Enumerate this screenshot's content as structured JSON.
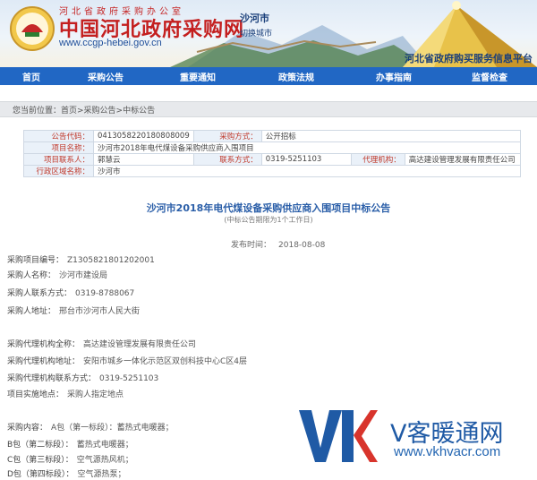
{
  "header": {
    "org_line": "河北省政府采购办公室",
    "site_title": "中国河北政府采购网",
    "site_url": "www.ccgp-hebei.gov.cn",
    "city_name": "沙河市",
    "city_switch": "切换城市",
    "platform_text": "河北省政府购买服务信息平台",
    "emblem_icon": "hebei-procurement-emblem-icon"
  },
  "nav": {
    "items": [
      "首页",
      "采购公告",
      "重要通知",
      "政策法规",
      "办事指南",
      "监督检查"
    ],
    "color": "#2167c4"
  },
  "breadcrumb": {
    "label": "您当前位置：",
    "path": "首页>采购公告>中标公告"
  },
  "info": {
    "announcement_code_label": "公告代码：",
    "announcement_code": "0413058220180808009",
    "method_label": "采购方式：",
    "method": "公开招标",
    "project_name_label": "项目名称：",
    "project_name": "沙河市2018年电代煤设备采购供应商入围项目",
    "contact_label": "项目联系人：",
    "contact": "郭慧云",
    "phone_label": "联系方式：",
    "phone": "0319-5251103",
    "agency_label": "代理机构：",
    "agency": "高达建设管理发展有限责任公司",
    "region_label": "行政区域名称：",
    "region": "沙河市"
  },
  "content": {
    "title": "沙河市2018年电代煤设备采购供应商入围项目中标公告",
    "subtitle": "(中标公告期限为1个工作日)",
    "publish_label": "发布时间：",
    "publish_date": "2018-08-08",
    "lines": [
      {
        "label": "采购项目编号：",
        "value": "Z1305821801202001"
      },
      {
        "label": "采购人名称：",
        "value": "沙河市建设局"
      },
      {
        "label": "采购人联系方式：",
        "value": "0319-8788067"
      },
      {
        "label": "采购人地址：",
        "value": "邢台市沙河市人民大街"
      },
      {
        "label": "采购代理机构全称：",
        "value": "高达建设管理发展有限责任公司"
      },
      {
        "label": "采购代理机构地址：",
        "value": "安阳市城乡一体化示范区双创科技中心C区4层"
      },
      {
        "label": "采购代理机构联系方式：",
        "value": "0319-5251103"
      },
      {
        "label": "项目实施地点：",
        "value": "采购人指定地点"
      },
      {
        "label": "采购内容：",
        "value": "A包（第一标段）：蓄热式电暖器；"
      },
      {
        "label": "B包（第二标段）：",
        "value": "蓄热式电暖器；"
      },
      {
        "label": "C包（第三标段）：",
        "value": "空气源热风机；"
      },
      {
        "label": "D包（第四标段）：",
        "value": "空气源热泵；"
      }
    ]
  },
  "watermark": {
    "title": "V客暖通网",
    "url": "www.vkhvacr.com",
    "logo_icon": "vk-logo-icon"
  }
}
